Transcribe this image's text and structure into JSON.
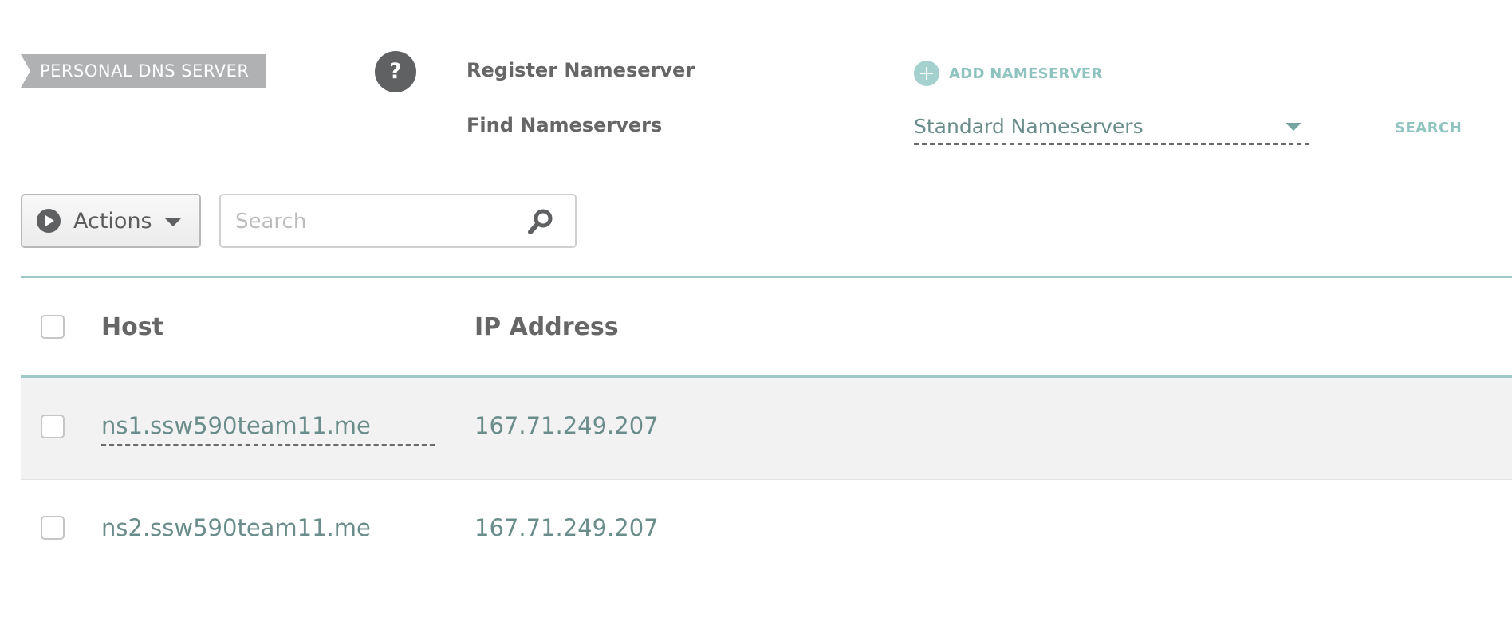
{
  "top": {
    "badge": "PERSONAL DNS SERVER",
    "help_glyph": "?",
    "register_label": "Register Nameserver",
    "add_nameserver": "ADD NAMESERVER",
    "find_label": "Find Nameservers",
    "find_select_value": "Standard Nameservers",
    "search_link": "SEARCH"
  },
  "toolbar": {
    "actions_label": "Actions",
    "search_placeholder": "Search",
    "search_value": ""
  },
  "table": {
    "headers": [
      "Host",
      "IP Address"
    ],
    "rows": [
      {
        "host": "ns1.ssw590team11.me",
        "ip": "167.71.249.207"
      },
      {
        "host": "ns2.ssw590team11.me",
        "ip": "167.71.249.207"
      }
    ]
  },
  "colors": {
    "accent": "#8fc3c0",
    "link": "#6a8d8b",
    "rule": "#9cc9c6",
    "badge_bg": "#b0b1b3",
    "row_alt_bg": "#f2f2f2"
  },
  "icons": [
    "help-icon",
    "plus-circle-icon",
    "chevron-down-icon",
    "play-icon",
    "magnifier-icon"
  ]
}
